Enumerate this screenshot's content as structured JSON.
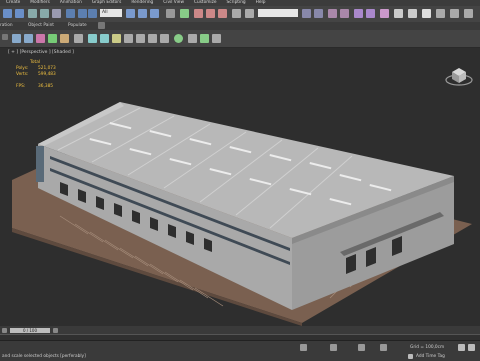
{
  "menu": [
    "Create",
    "Modifiers",
    "Animation",
    "Graph Editors",
    "Rendering",
    "Civil View",
    "Customize",
    "Scripting",
    "Help"
  ],
  "toolbar": {
    "selection_filter": "All"
  },
  "ribbon": {
    "left_label": "ration",
    "panel_label": "Object Paint",
    "populate_label": "Populate"
  },
  "viewport": {
    "label": "[ + ] [Perspective ] [Shaded ]"
  },
  "stats": {
    "header": "Total",
    "rows": [
      {
        "key": "Polys:",
        "value": "521,073"
      },
      {
        "key": "Verts:",
        "value": "599,483"
      }
    ],
    "fps_key": "FPS:",
    "fps_value": "36,385"
  },
  "timeline": {
    "slider_label": "0 / 100"
  },
  "status": {
    "hint": "and scale selected objects [perferably]",
    "grid": "Grid = 100,0cm",
    "add_tag": "Add Time Tag"
  },
  "colors": {
    "accent_yellow": "#f0c040",
    "ground": "#7a6050",
    "roof": "#b8b8b8",
    "wall": "#a9a9a9"
  }
}
